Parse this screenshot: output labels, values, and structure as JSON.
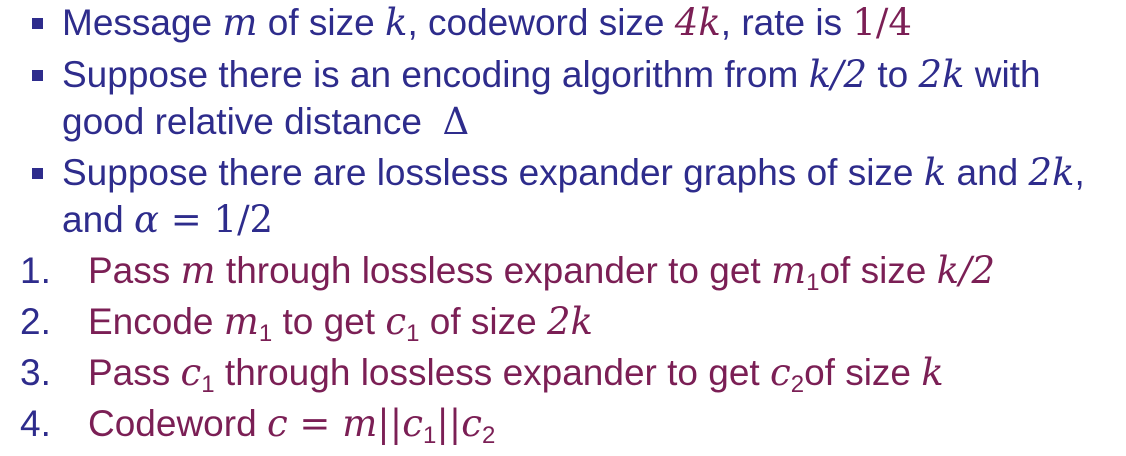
{
  "bullets": [
    {
      "parts": [
        "Message ",
        "m",
        " of size ",
        "k",
        ", codeword size ",
        "4k",
        ", rate is ",
        "1/4"
      ]
    },
    {
      "line1": [
        "Suppose there is an encoding algorithm from ",
        "k/2",
        " to ",
        "2k",
        " with"
      ],
      "line2": [
        "good relative distance  ",
        "Δ"
      ]
    },
    {
      "line1": [
        "Suppose there are lossless expander graphs of size ",
        "k",
        " and ",
        "2k",
        ","
      ],
      "line2": [
        "and ",
        "α",
        " = 1/2"
      ]
    }
  ],
  "steps": [
    {
      "number": "1.",
      "parts": [
        "Pass ",
        "m",
        " through lossless expander to get ",
        "m",
        "1",
        "of size ",
        "k/2"
      ]
    },
    {
      "number": "2.",
      "parts": [
        "Encode ",
        "m",
        "1",
        " to get ",
        "c",
        "1",
        " of size ",
        "2k"
      ]
    },
    {
      "number": "3.",
      "parts": [
        "Pass ",
        "c",
        "1",
        " through lossless expander to get ",
        "c",
        "2",
        "of size ",
        "k"
      ]
    },
    {
      "number": "4.",
      "parts": [
        "Codeword ",
        "c",
        " = ",
        "m",
        "||",
        "c",
        "1",
        "||",
        "c",
        "2"
      ]
    }
  ],
  "colors": {
    "bullet_text": "#2e2c8c",
    "step_text": "#7b1f55"
  }
}
